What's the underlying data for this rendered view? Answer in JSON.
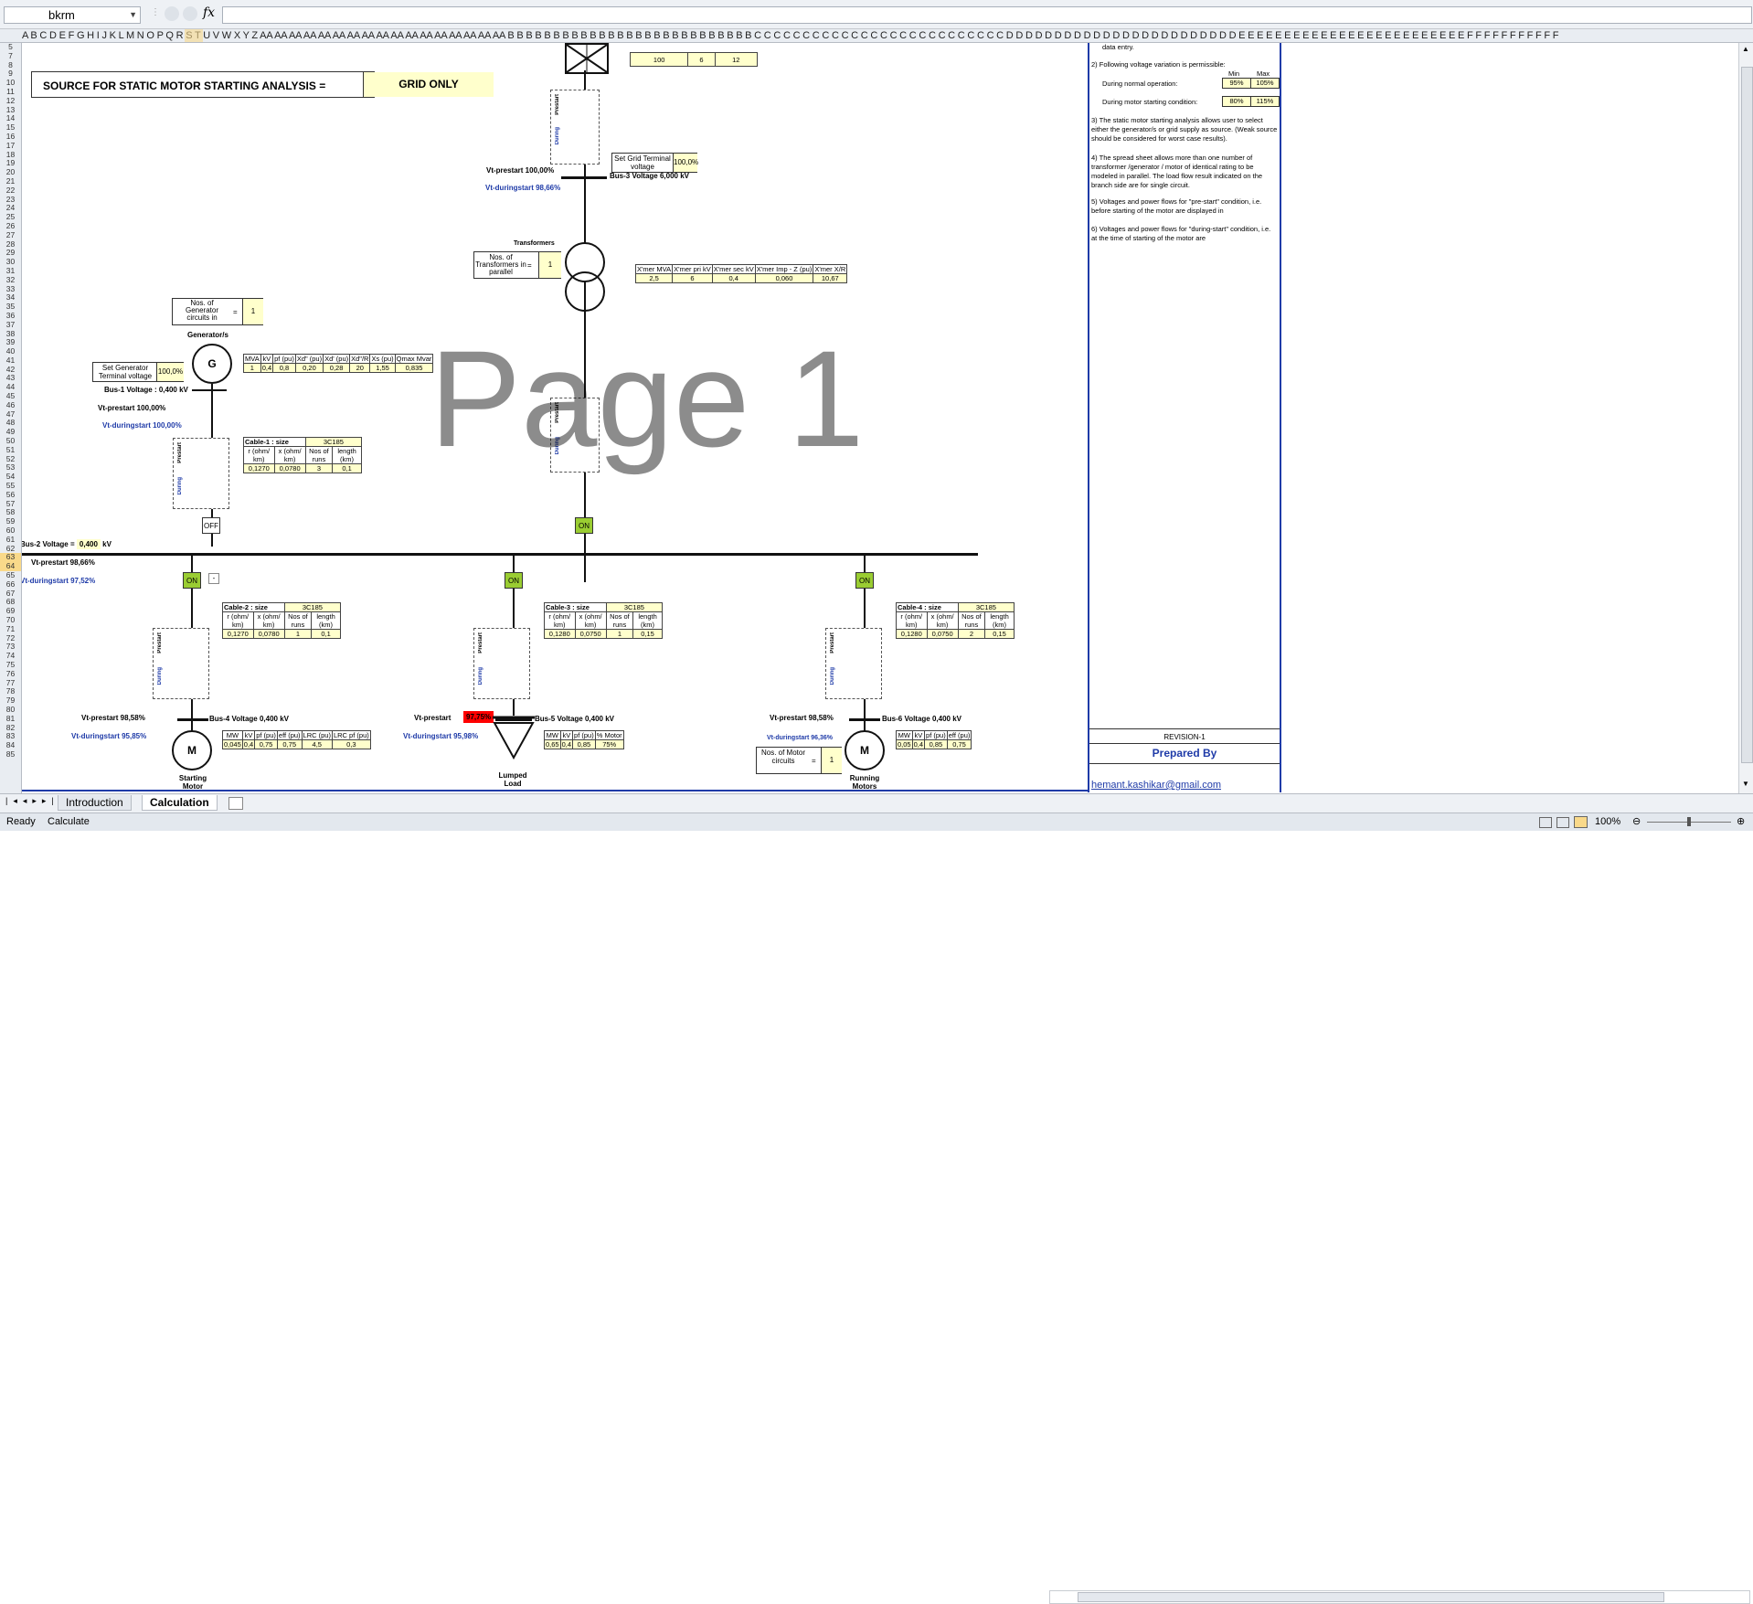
{
  "formula_bar": {
    "name_box": "bkrm",
    "fx": "fx",
    "formula": ""
  },
  "columns": "A B C D E F G H I J K L M N O P Q R S T U V W X Y Z AA AA AA AA AA AA AA AA AA AA AA AA AA AA AA AA AA B B B B B B B B B B B B B B B B B B B B B B B B B B B C C C C C C C C C C C C C C C C C C C C C C C C C C D D D D D D D D D D D D D D D D D D D D D D D D E E E E E E E E E E E E E E E E E E E E E E E E E F F F F F F F F F F F",
  "rows": [
    "5",
    "7",
    "8",
    "9",
    "10",
    "11",
    "12",
    "13",
    "14",
    "15",
    "16",
    "17",
    "18",
    "19",
    "20",
    "21",
    "22",
    "23",
    "24",
    "25",
    "26",
    "27",
    "28",
    "29",
    "30",
    "31",
    "32",
    "33",
    "34",
    "35",
    "36",
    "37",
    "38",
    "39",
    "40",
    "41",
    "42",
    "43",
    "44",
    "45",
    "46",
    "47",
    "48",
    "49",
    "50",
    "51",
    "52",
    "53",
    "54",
    "55",
    "56",
    "57",
    "58",
    "59",
    "60",
    "61",
    "62",
    "63",
    "64",
    "65",
    "66",
    "67",
    "68",
    "69",
    "70",
    "71",
    "72",
    "73",
    "74",
    "75",
    "76",
    "77",
    "78",
    "79",
    "80",
    "81",
    "82",
    "83",
    "84",
    "85"
  ],
  "diagram": {
    "source_label": "SOURCE FOR STATIC MOTOR STARTING ANALYSIS =",
    "source_value": "GRID ONLY",
    "grid_top": {
      "v1": "100",
      "v2": "6",
      "v3": "12"
    },
    "set_grid_label": "Set Grid Terminal voltage",
    "set_grid_value": "100,0%",
    "bus3": "Bus-3 Voltage  6,000 kV",
    "vt_prestart_top": "Vt-prestart  100,00%",
    "vt_during_top": "Vt-duringstart  98,66%",
    "transformers_label": "Transformers",
    "nos_transformers": "Nos. of Transformers in parallel",
    "eq": "=",
    "nos_trans_value": "1",
    "xmer": {
      "headers": [
        "X'mer MVA",
        "X'mer pri kV",
        "X'mer sec kV",
        "X'mer Imp - Z (pu)",
        "X'mer X/R"
      ],
      "values": [
        "2,5",
        "6",
        "0,4",
        "0,060",
        "10,67"
      ]
    },
    "nos_gen_label": "Nos. of Generator circuits in",
    "nos_gen_value": "1",
    "generators_label": "Generator/s",
    "gen_symbol": "G",
    "set_gen_label": "Set Generator Terminal voltage",
    "set_gen_value": "100,0%",
    "gen": {
      "headers": [
        "MVA",
        "kV",
        "pf (pu)",
        "Xd\" (pu)",
        "Xd' (pu)",
        "Xd\"/R",
        "Xs (pu)",
        "Qmax Mvar"
      ],
      "values": [
        "1",
        "0,4",
        "0,8",
        "0,20",
        "0,28",
        "20",
        "1,55",
        "0,835"
      ]
    },
    "bus1": "Bus-1 Voltage : 0,400 kV",
    "vt_prestart_gen": "Vt-prestart  100,00%",
    "vt_during_gen": "Vt-duringstart  100,00%",
    "cable1": {
      "label": "Cable-1 : size",
      "size": "3C185",
      "headers": [
        "r (ohm/ km)",
        "x (ohm/ km)",
        "Nos of runs",
        "length (km)"
      ],
      "values": [
        "0,1270",
        "0,0780",
        "3",
        "0,1"
      ]
    },
    "off": "OFF",
    "on": "ON",
    "bus2_label": "Bus-2 Voltage =",
    "bus2_value": "0,400",
    "bus2_unit": "kV",
    "vt_prestart_bus2": "Vt-prestart  98,66%",
    "vt_during_bus2": "Vt-duringstart  97,52%",
    "cable2": {
      "label": "Cable-2 : size",
      "size": "3C185",
      "headers": [
        "r (ohm/ km)",
        "x (ohm/ km)",
        "Nos of runs",
        "length (km)"
      ],
      "values": [
        "0,1270",
        "0,0780",
        "1",
        "0,1"
      ]
    },
    "cable3": {
      "label": "Cable-3 : size",
      "size": "3C185",
      "headers": [
        "r (ohm/ km)",
        "x (ohm/ km)",
        "Nos of runs",
        "length (km)"
      ],
      "values": [
        "0,1280",
        "0,0750",
        "1",
        "0,15"
      ]
    },
    "cable4": {
      "label": "Cable-4 : size",
      "size": "3C185",
      "headers": [
        "r (ohm/ km)",
        "x (ohm/ km)",
        "Nos of runs",
        "length (km)"
      ],
      "values": [
        "0,1280",
        "0,0750",
        "2",
        "0,15"
      ]
    },
    "bus4": "Bus-4 Voltage  0,400 kV",
    "bus5": "Bus-5 Voltage  0,400 kV",
    "bus6": "Bus-6 Voltage  0,400 kV",
    "vt_prestart_b4": "Vt-prestart  98,58%",
    "vt_during_b4": "Vt-duringstart  95,85%",
    "vt_prestart_b5": "Vt-prestart",
    "vt_prestart_b5_val": "97,75%",
    "vt_during_b5": "Vt-duringstart  95,98%",
    "vt_prestart_b6": "Vt-prestart  98,58%",
    "vt_during_b6": "Vt-duringstart  96,36%",
    "motor_start": {
      "headers": [
        "MW",
        "kV",
        "pf (pu)",
        "eff (pu)",
        "LRC (pu)",
        "LRC pf (pu)"
      ],
      "values": [
        "0,045",
        "0,4",
        "0,75",
        "0,75",
        "4,5",
        "0,3"
      ]
    },
    "lumped": {
      "headers": [
        "MW",
        "kV",
        "pf (pu)",
        "% Motor"
      ],
      "values": [
        "0,65",
        "0,4",
        "0,85",
        "75%"
      ]
    },
    "running": {
      "headers": [
        "MW",
        "kV",
        "pf (pu)",
        "eff (pu)"
      ],
      "values": [
        "0,05",
        "0,4",
        "0,85",
        "0,75"
      ]
    },
    "motor_symbol": "M",
    "starting_motor": "Starting Motor",
    "lumped_load": "Lumped Load",
    "running_motors": "Running Motors",
    "nos_motor_label": "Nos. of Motor circuits",
    "nos_motor_value": "1",
    "prestart": "Prestart",
    "during": "During",
    "watermark": "Page 1"
  },
  "notes": {
    "n0": "data entry.",
    "n2": "2)  Following voltage variation is permissible:",
    "min": "Min",
    "max": "Max",
    "normal": "During normal operation:",
    "normal_min": "95%",
    "normal_max": "105%",
    "starting": "During motor starting condition:",
    "start_min": "80%",
    "start_max": "115%",
    "n3": "3)  The static motor starting analysis allows user to select either the generator/s or grid supply as source. (Weak source should be considered for worst case results).",
    "n4": "4)  The spread sheet allows more than one number of transformer /generator / motor of identical rating to be modeled in parallel. The load flow result indicated on the branch side are for single circuit.",
    "n5": "5)  Voltages and power flows for \"pre-start\" condition, i.e. before starting of the motor are displayed in",
    "n6": "6)  Voltages and power flows for \"during-start\" condition, i.e. at the time of starting of the motor are",
    "revision": "REVISION-1",
    "prepared": "Prepared By",
    "email": "hemant.kashikar@gmail.com"
  },
  "tabs": [
    "Introduction",
    "Calculation"
  ],
  "status": {
    "ready": "Ready",
    "calculate": "Calculate",
    "zoom": "100%"
  }
}
